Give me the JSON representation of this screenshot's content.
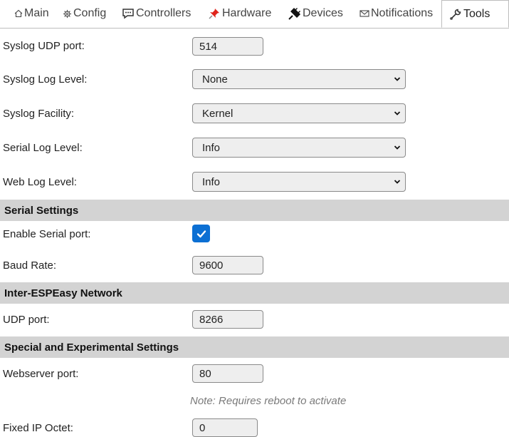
{
  "tabs": [
    {
      "label": "Main",
      "icon": "home-icon"
    },
    {
      "label": "Config",
      "icon": "gear-icon"
    },
    {
      "label": "Controllers",
      "icon": "speech-bubble-icon"
    },
    {
      "label": "Hardware",
      "icon": "pushpin-icon"
    },
    {
      "label": "Devices",
      "icon": "plug-icon"
    },
    {
      "label": "Notifications",
      "icon": "envelope-icon"
    },
    {
      "label": "Tools",
      "icon": "wrench-icon",
      "active": true
    }
  ],
  "syslog": {
    "udp_port_label": "Syslog UDP port:",
    "udp_port_value": "514",
    "log_level_label": "Syslog Log Level:",
    "log_level_value": "None",
    "facility_label": "Syslog Facility:",
    "facility_value": "Kernel"
  },
  "serial_log": {
    "label": "Serial Log Level:",
    "value": "Info"
  },
  "web_log": {
    "label": "Web Log Level:",
    "value": "Info"
  },
  "serial_settings": {
    "heading": "Serial Settings",
    "enable_label": "Enable Serial port:",
    "enable_checked": true,
    "baud_label": "Baud Rate:",
    "baud_value": "9600"
  },
  "inter_espeasy": {
    "heading": "Inter-ESPEasy Network",
    "udp_label": "UDP port:",
    "udp_value": "8266"
  },
  "special": {
    "heading": "Special and Experimental Settings",
    "webserver_label": "Webserver port:",
    "webserver_value": "80",
    "webserver_note": "Note: Requires reboot to activate",
    "fixed_ip_label": "Fixed IP Octet:",
    "fixed_ip_value": "0"
  },
  "colors": {
    "section_bg": "#d3d3d3",
    "checkbox_accent": "#0b6fd3",
    "field_bg": "#eeeeee"
  }
}
